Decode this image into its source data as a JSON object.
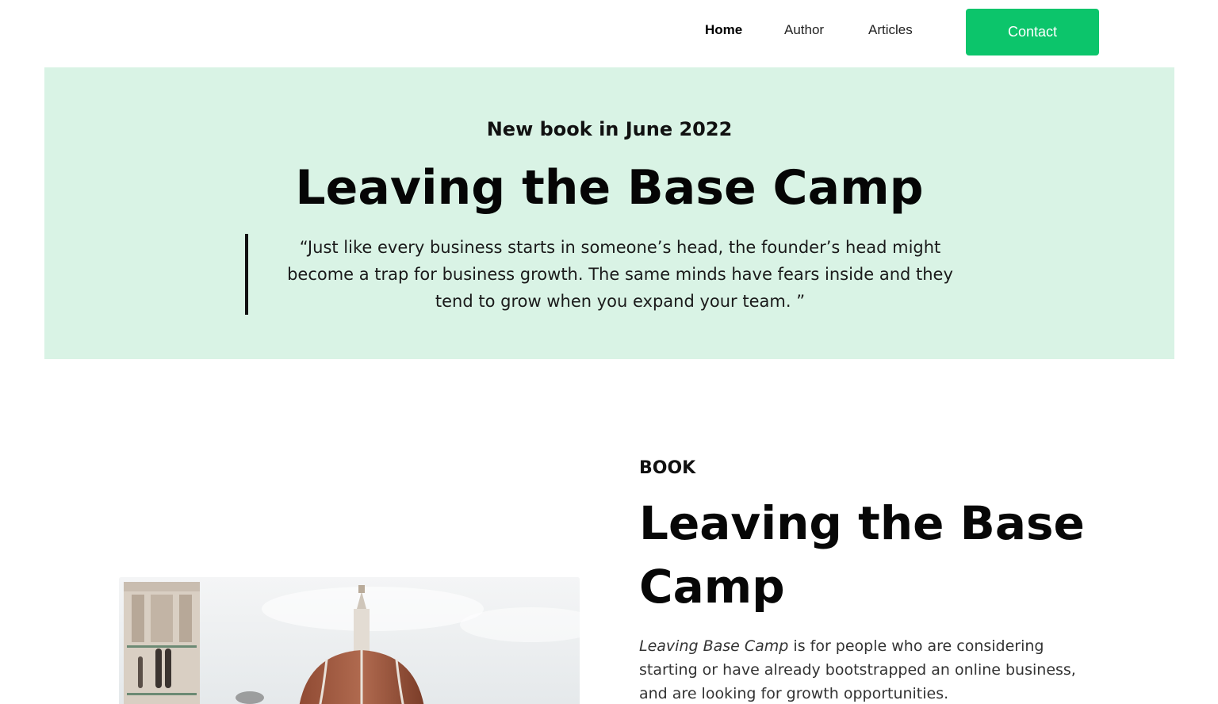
{
  "nav": {
    "links": [
      {
        "label": "Home",
        "active": true
      },
      {
        "label": "Author",
        "active": false
      },
      {
        "label": "Articles",
        "active": false
      }
    ],
    "contact_label": "Contact"
  },
  "hero": {
    "eyebrow": "New book in June 2022",
    "title": "Leaving the Base Camp",
    "quote_lines": [
      "“Just like every business starts in someone’s head, the founder’s head might",
      "become a trap for business growth. The same minds have fears inside and they",
      "tend to grow when you expand your team. ”"
    ]
  },
  "book": {
    "label": "BOOK",
    "title_lines": [
      "Leaving the Base",
      "Camp"
    ],
    "desc_italic": "Leaving Base Camp",
    "desc_rest_lines": [
      " is for people who are considering",
      "starting or have already bootstrapped an online business,",
      "and are looking for growth opportunities."
    ]
  },
  "colors": {
    "accent": "#0cc56b",
    "hero_bg": "#d9f3e5"
  }
}
